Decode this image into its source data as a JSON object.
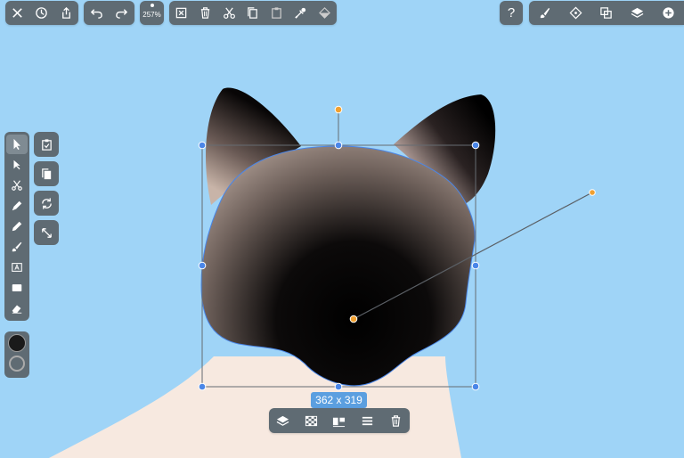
{
  "toolbar": {
    "zoom_level": "257%",
    "left_group": [
      {
        "name": "close-icon"
      },
      {
        "name": "history-icon"
      },
      {
        "name": "share-icon"
      }
    ],
    "history_group": [
      {
        "name": "undo-icon"
      },
      {
        "name": "redo-icon"
      }
    ],
    "edit_group": [
      {
        "name": "deselect-icon"
      },
      {
        "name": "trash-icon"
      },
      {
        "name": "cut-icon"
      },
      {
        "name": "copy-icon"
      },
      {
        "name": "paste-icon"
      },
      {
        "name": "eyedropper-icon"
      },
      {
        "name": "fill-icon"
      }
    ],
    "help_label": "?",
    "right_group": [
      {
        "name": "brush-settings-icon"
      },
      {
        "name": "guides-icon"
      },
      {
        "name": "boolean-icon"
      },
      {
        "name": "layers-icon"
      },
      {
        "name": "add-icon"
      }
    ]
  },
  "tools": [
    {
      "name": "select-tool",
      "active": true
    },
    {
      "name": "direct-select-tool",
      "active": false
    },
    {
      "name": "scissors-tool",
      "active": false
    },
    {
      "name": "pen-tool",
      "active": false
    },
    {
      "name": "pencil-tool",
      "active": false
    },
    {
      "name": "brush-tool",
      "active": false
    },
    {
      "name": "text-tool",
      "active": false
    },
    {
      "name": "rectangle-tool",
      "active": false
    },
    {
      "name": "eraser-tool",
      "active": false
    }
  ],
  "colors": {
    "fill_color": "#1a1a1a",
    "stroke_color": "#aaaaaa",
    "toolbar_bg": "#5f6b73",
    "canvas_bg": "#9fd4f7",
    "accent": "#4a86e8",
    "gradient_handle": "#f0a030",
    "body_color": "#f7e9e0"
  },
  "selection": {
    "size_label": "362 x 319"
  },
  "bottom_bar": [
    {
      "name": "arrange-icon"
    },
    {
      "name": "transparency-icon"
    },
    {
      "name": "align-icon"
    },
    {
      "name": "distribute-icon"
    },
    {
      "name": "delete-icon"
    }
  ]
}
